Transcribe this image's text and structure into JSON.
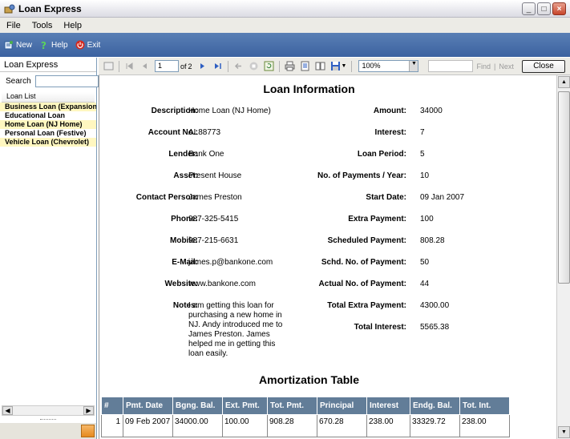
{
  "window": {
    "title": "Loan Express"
  },
  "menu": [
    "File",
    "Tools",
    "Help"
  ],
  "toolbar": {
    "new": "New",
    "help": "Help",
    "exit": "Exit"
  },
  "sidebar": {
    "title": "Loan Express",
    "search_label": "Search",
    "search_value": "",
    "list_header": "Loan List",
    "items": [
      {
        "label": "Business Loan (Expansion)"
      },
      {
        "label": "Educational Loan"
      },
      {
        "label": "Home Loan (NJ Home)"
      },
      {
        "label": "Personal Loan (Festive)"
      },
      {
        "label": "Vehicle Loan (Chevrolet)"
      }
    ]
  },
  "viewer": {
    "page_current": "1",
    "page_of": "of",
    "page_total": "2",
    "zoom": "100%",
    "find": "Find",
    "next": "Next",
    "sep": "|",
    "close": "Close"
  },
  "report": {
    "title": "Loan Information",
    "left": [
      {
        "label": "Description:",
        "value": "Home Loan (NJ Home)"
      },
      {
        "label": "Account No.:",
        "value": "AL88773"
      },
      {
        "label": "Lender:",
        "value": "Bank One"
      },
      {
        "label": "Asset:",
        "value": "Present House"
      },
      {
        "label": "Contact Person:",
        "value": "James Preston"
      },
      {
        "label": "Phone:",
        "value": "987-325-5415"
      },
      {
        "label": "Mobile:",
        "value": "987-215-6631"
      },
      {
        "label": "E-Mail:",
        "value": "james.p@bankone.com"
      },
      {
        "label": "Website:",
        "value": "www.bankone.com"
      },
      {
        "label": "Notes:",
        "value": "I am getting this loan for purchasing a new home in NJ. Andy introduced me to James Preston. James helped me in getting this loan easily."
      }
    ],
    "right": [
      {
        "label": "Amount:",
        "value": "34000"
      },
      {
        "label": "Interest:",
        "value": "7"
      },
      {
        "label": "Loan Period:",
        "value": "5"
      },
      {
        "label": "No. of Payments / Year:",
        "value": "10"
      },
      {
        "label": "Start Date:",
        "value": "09 Jan 2007"
      },
      {
        "label": "Extra Payment:",
        "value": "100"
      },
      {
        "label": "Scheduled Payment:",
        "value": "808.28"
      },
      {
        "label": "Schd. No. of Payment:",
        "value": "50"
      },
      {
        "label": "Actual No. of Payment:",
        "value": "44"
      },
      {
        "label": "Total Extra Payment:",
        "value": "4300.00"
      },
      {
        "label": "Total Interest:",
        "value": "5565.38"
      }
    ],
    "amort_title": "Amortization Table",
    "amort_headers": [
      "#",
      "Pmt. Date",
      "Bgng. Bal.",
      "Ext. Pmt.",
      "Tot. Pmt.",
      "Principal",
      "Interest",
      "Endg. Bal.",
      "Tot. Int."
    ],
    "amort_rows": [
      [
        "1",
        "09 Feb 2007",
        "34000.00",
        "100.00",
        "908.28",
        "670.28",
        "238.00",
        "33329.72",
        "238.00"
      ]
    ]
  },
  "colors": {
    "toolbar_blue": "#4a70ad",
    "table_header": "#627d98",
    "highlight": "#fff7c0"
  }
}
